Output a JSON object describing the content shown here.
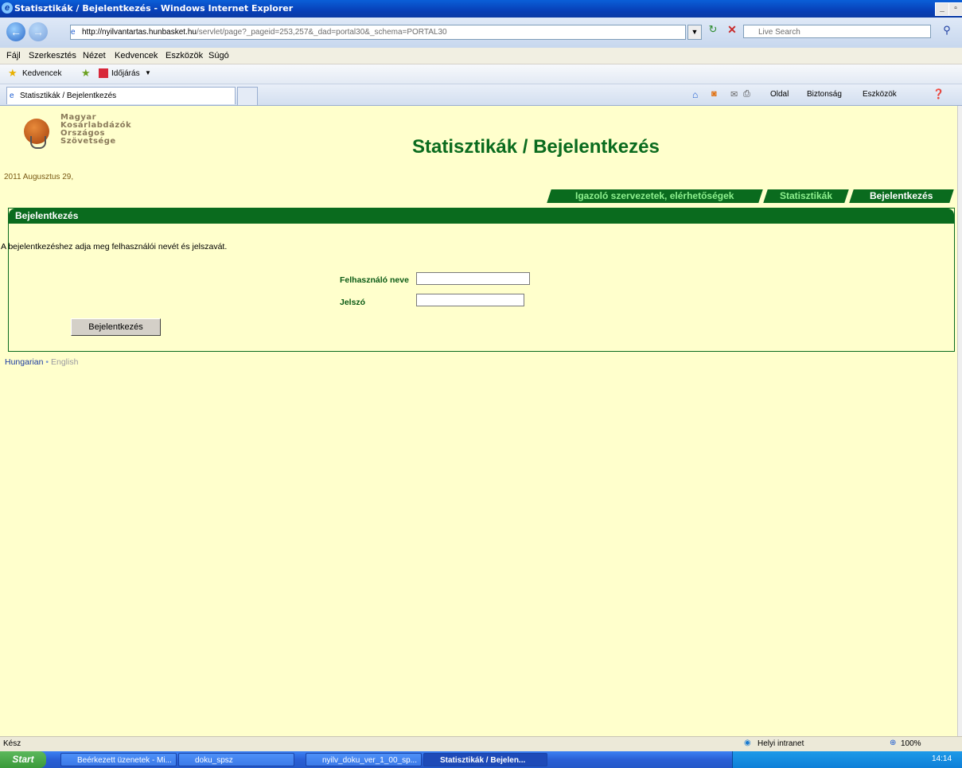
{
  "window": {
    "title": "Statisztikák / Bejelentkezés - Windows Internet Explorer"
  },
  "address": {
    "host": "http://nyilvantartas.hunbasket.hu",
    "rest": "/servlet/page?_pageid=253,257&_dad=portal30&_schema=PORTAL30"
  },
  "search": {
    "placeholder": "Live Search"
  },
  "menu": [
    "Fájl",
    "Szerkesztés",
    "Nézet",
    "Kedvencek",
    "Eszközök",
    "Súgó"
  ],
  "favbar": {
    "favorites": "Kedvencek",
    "weather": "Időjárás"
  },
  "browser_tab": {
    "title": "Statisztikák / Bejelentkezés"
  },
  "commandbar": {
    "page": "Oldal",
    "safety": "Biztonság",
    "tools": "Eszközök"
  },
  "logo": {
    "line1": "Magyar",
    "line2": "Kosárlabdázók",
    "line3": "Országos",
    "line4": "Szövetsége"
  },
  "page": {
    "title": "Statisztikák / Bejelentkezés",
    "date": "2011 Augusztus 29,",
    "tabs": [
      "Igazoló szervezetek, elérhetőségek",
      "Statisztikák",
      "Bejelentkezés"
    ],
    "panel_title": "Bejelentkezés",
    "instruction": "A bejelentkezéshez adja meg felhasználói nevét és jelszavát.",
    "username_label": "Felhasználó neve",
    "password_label": "Jelszó",
    "login_button": "Bejelentkezés",
    "lang_hu": "Hungarian",
    "lang_sep": "•",
    "lang_en": "English"
  },
  "status": {
    "text": "Kész",
    "zone": "Helyi intranet",
    "zoom": "100%"
  },
  "taskbar": {
    "start": "Start",
    "items": [
      "Beérkezett üzenetek - Mi...",
      "doku_spsz",
      "nyilv_doku_ver_1_00_sp...",
      "Statisztikák / Bejelen..."
    ],
    "clock": "14:14"
  }
}
